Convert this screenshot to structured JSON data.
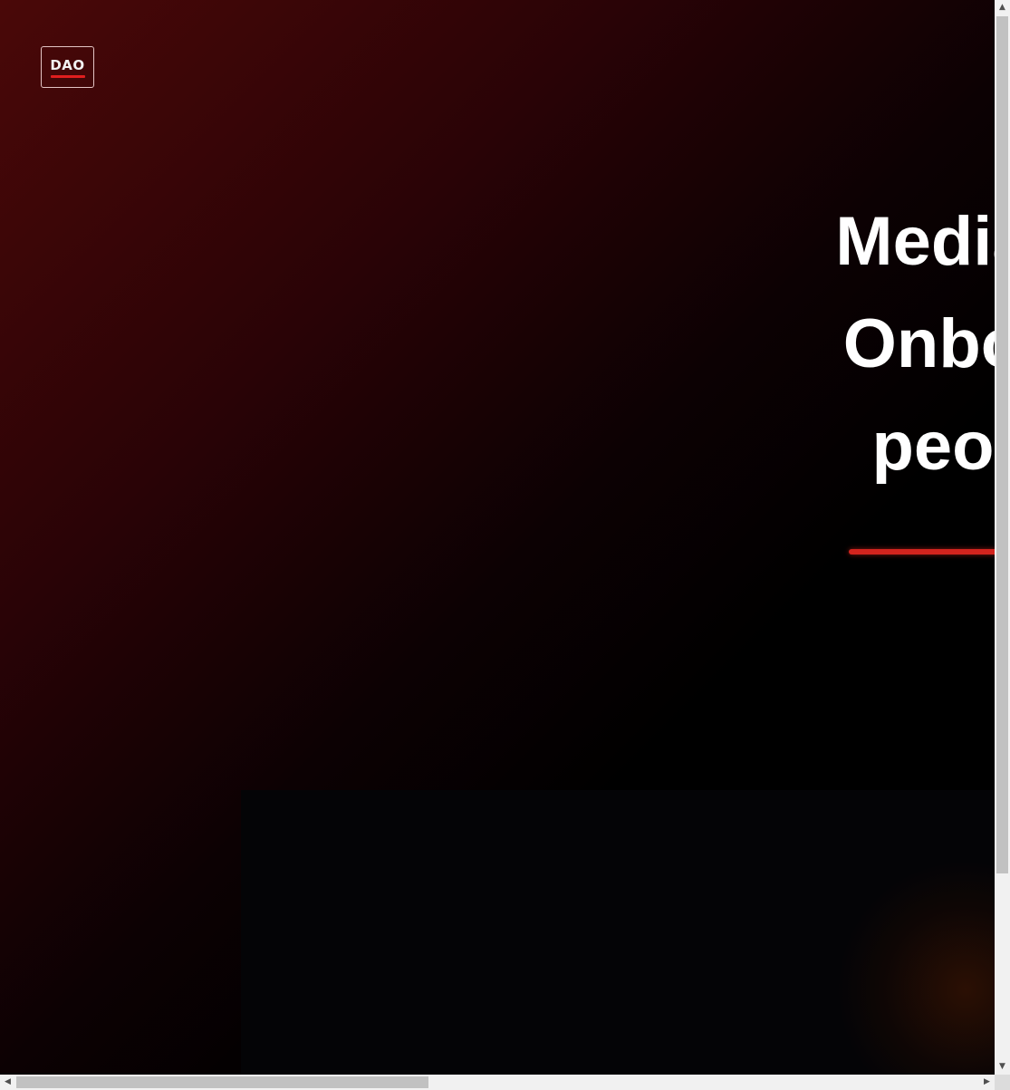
{
  "header": {
    "logo_text": "DAO"
  },
  "hero": {
    "lines": [
      "Media",
      "Onbo",
      "peo"
    ]
  },
  "colors": {
    "accent": "#d3241e",
    "background_top": "#4a0808",
    "background": "#000000"
  },
  "icons": {
    "scroll_up": "arrow-up-icon",
    "scroll_down": "arrow-down-icon",
    "scroll_left": "arrow-left-icon",
    "scroll_right": "arrow-right-icon"
  }
}
